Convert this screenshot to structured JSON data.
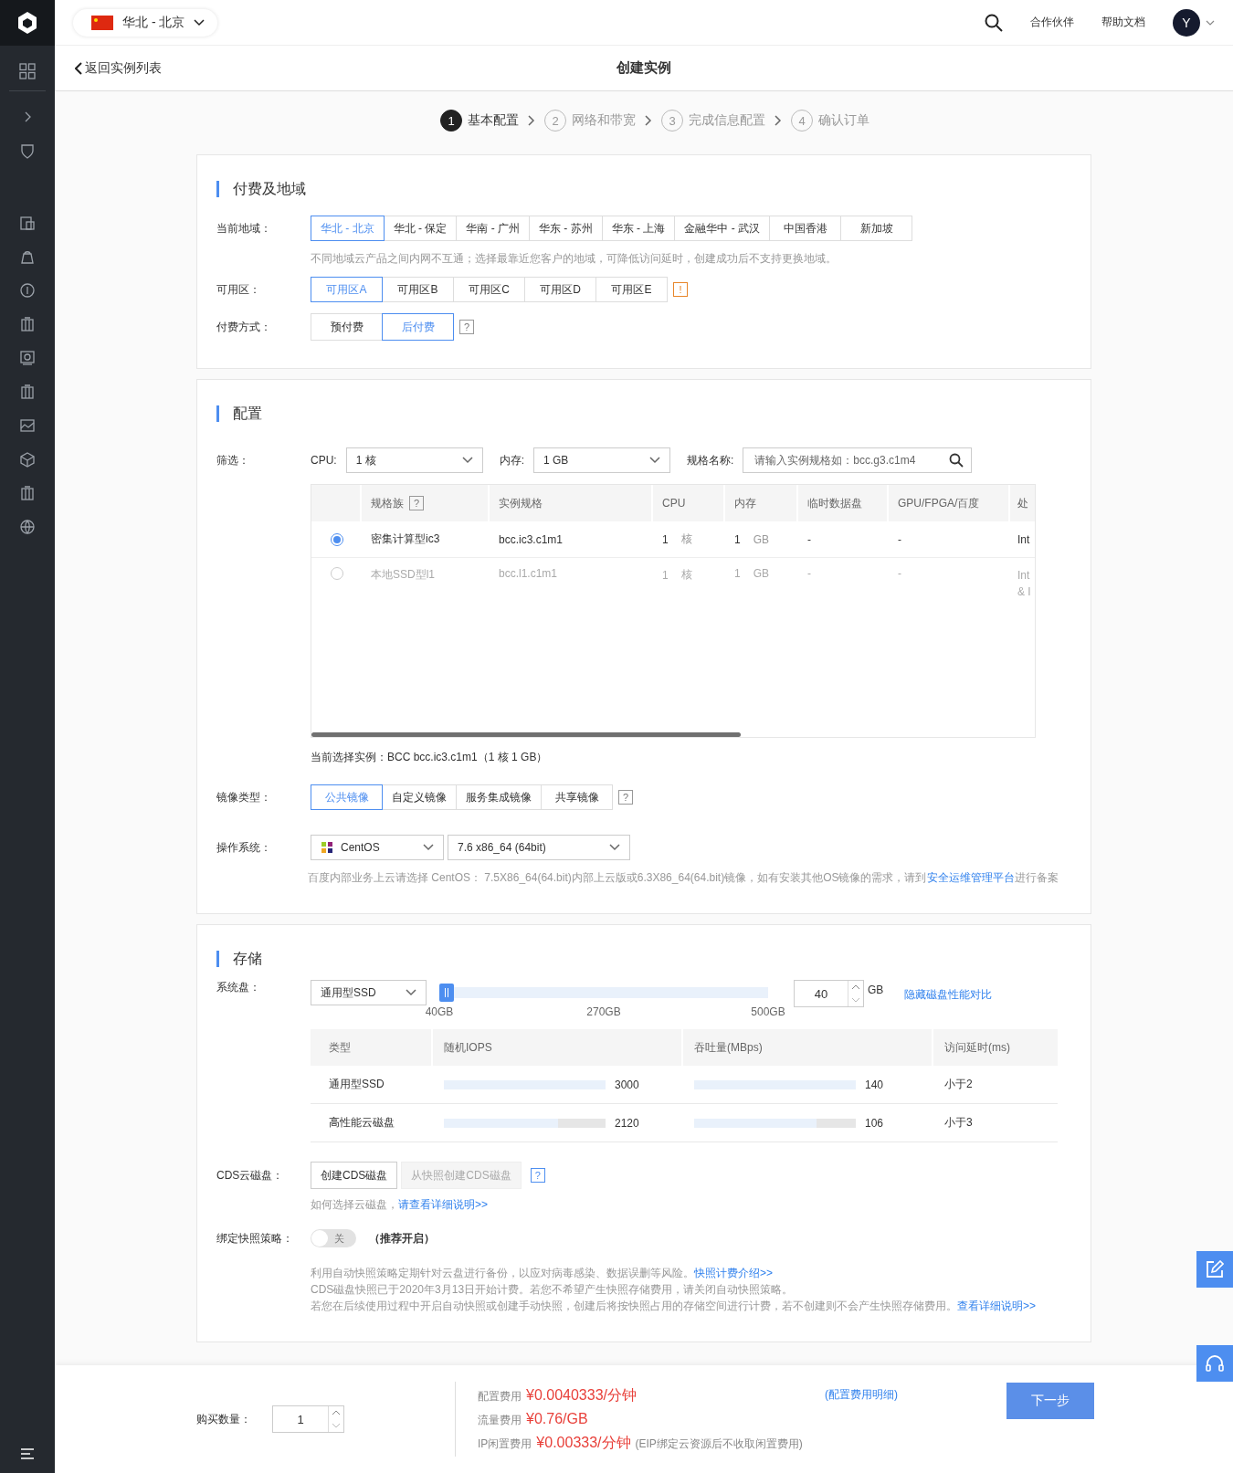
{
  "topbar": {
    "region": "华北 - 北京",
    "links": [
      "合作伙伴",
      "帮助文档"
    ],
    "avatar": "Y"
  },
  "header": {
    "back": "返回实例列表",
    "title": "创建实例"
  },
  "steps": [
    {
      "number": "1",
      "label": "基本配置",
      "selected": true
    },
    {
      "number": "2",
      "label": "网络和带宽",
      "selected": false
    },
    {
      "number": "3",
      "label": "完成信息配置",
      "selected": false
    },
    {
      "number": "4",
      "label": "确认订单",
      "selected": false
    }
  ],
  "billing": {
    "title": "付费及地域",
    "region_label": "当前地域：",
    "regions": [
      {
        "label": "华北 - 北京",
        "selected": true
      },
      {
        "label": "华北 - 保定",
        "selected": false
      },
      {
        "label": "华南 - 广州",
        "selected": false
      },
      {
        "label": "华东 - 苏州",
        "selected": false
      },
      {
        "label": "华东 - 上海",
        "selected": false
      },
      {
        "label": "金融华中 - 武汉",
        "selected": false
      },
      {
        "label": "中国香港",
        "selected": false
      },
      {
        "label": "新加坡",
        "selected": false
      }
    ],
    "region_hint": "不同地域云产品之间内网不互通；选择最靠近您客户的地域，可降低访问延时，创建成功后不支持更换地域。",
    "zone_label": "可用区：",
    "zones": [
      {
        "label": "可用区A",
        "selected": true
      },
      {
        "label": "可用区B",
        "selected": false
      },
      {
        "label": "可用区C",
        "selected": false
      },
      {
        "label": "可用区D",
        "selected": false
      },
      {
        "label": "可用区E",
        "selected": false
      }
    ],
    "zone_warning": "!",
    "payment_label": "付费方式：",
    "payments": [
      {
        "label": "预付费",
        "selected": false
      },
      {
        "label": "后付费",
        "selected": true
      }
    ],
    "payment_help": "?"
  },
  "config": {
    "title": "配置",
    "filter_label": "筛选：",
    "cpu_label": "CPU:",
    "cpu_value": "1 核",
    "memory_label": "内存:",
    "memory_value": "1 GB",
    "spec_label": "规格名称:",
    "spec_placeholder": "请输入实例规格如：bcc.g3.c1m4",
    "table": {
      "columns": [
        {
          "label": "规格族",
          "help": "?"
        },
        {
          "label": "实例规格"
        },
        {
          "label": "CPU"
        },
        {
          "label": "内存"
        },
        {
          "label": "临时数据盘"
        },
        {
          "label": "GPU/FPGA/百度"
        },
        {
          "label": "处"
        }
      ],
      "rows": [
        {
          "selected": true,
          "disabled": false,
          "family": "密集计算型ic3",
          "spec": "bcc.ic3.c1m1",
          "cpu": "1",
          "cpu_unit": "核",
          "memory": "1",
          "memory_unit": "GB",
          "disk": "-",
          "gpu": "-",
          "column_7": "Int"
        },
        {
          "selected": false,
          "disabled": true,
          "family": "本地SSD型l1",
          "spec": "bcc.l1.c1m1",
          "cpu": "1",
          "cpu_unit": "核",
          "memory": "1",
          "memory_unit": "GB",
          "disk": "-",
          "gpu": "-",
          "column_7": "Int & I"
        }
      ]
    },
    "current": "当前选择实例：BCC bcc.ic3.c1m1（1 核 1 GB）",
    "image_label": "镜像类型：",
    "images": [
      {
        "label": "公共镜像",
        "selected": true
      },
      {
        "label": "自定义镜像",
        "selected": false
      },
      {
        "label": "服务集成镜像",
        "selected": false
      },
      {
        "label": "共享镜像",
        "selected": false
      }
    ],
    "image_help": "?",
    "os_label": "操作系统：",
    "os": "CentOS",
    "os_version": "7.6 x86_64 (64bit)",
    "os_hint": "百度内部业务上云请选择 CentOS： 7.5X86_64(64.bit)内部上云版或6.3X86_64(64.bit)镜像，如有安装其他OS镜像的需求，请到",
    "os_hint_link": "安全运维管理平台",
    "os_hint_end": "进行备案"
  },
  "storage": {
    "title": "存储",
    "disk_label": "系统盘：",
    "disk_type": "通用型SSD",
    "level": 0,
    "ticks": [
      "40GB",
      "270GB",
      "500GB"
    ],
    "size": "40",
    "unit": "GB",
    "compare_link": "隐藏磁盘性能对比",
    "perf_columns": [
      "类型",
      "随机IOPS",
      "吞吐量(MBps)",
      "访问延时(ms)"
    ],
    "perf_rows": [
      {
        "type": "通用型SSD",
        "iops": {
          "level": 1,
          "reading": "3000"
        },
        "throughput": {
          "level": 1,
          "reading": "140"
        },
        "latency": "小于2"
      },
      {
        "type": "高性能云磁盘",
        "iops": {
          "level": 0.707,
          "reading": "2120"
        },
        "throughput": {
          "level": 0.757,
          "reading": "106"
        },
        "latency": "小于3"
      }
    ],
    "cds_label": "CDS云磁盘：",
    "cds_buttons": [
      {
        "label": "创建CDS磁盘",
        "disabled": false
      },
      {
        "label": "从快照创建CDS磁盘",
        "disabled": true
      }
    ],
    "cds_help": "?",
    "cds_hint": "如何选择云磁盘，",
    "cds_hint_link": "请查看详细说明>>",
    "snapshot_label": "绑定快照策略：",
    "snapshot_on": false,
    "snapshot_switch_text": "关",
    "snapshot_recommend": "（推荐开启）",
    "notes": [
      {
        "text": "利用自动快照策略定期针对云盘进行备份，以应对病毒感染、数据误删等风险。",
        "link": "快照计费介绍>>"
      },
      {
        "text": "CDS磁盘快照已于2020年3月13日开始计费。若您不希望产生快照存储费用，请关闭自动快照策略。"
      },
      {
        "text": "若您在后续使用过程中开启自动快照或创建手动快照，创建后将按快照占用的存储空间进行计费，若不创建则不会产生快照存储费用。",
        "link": "查看详细说明>>"
      }
    ]
  },
  "footer": {
    "quantity_label": "购买数量：",
    "quantity": "1",
    "fees": [
      {
        "label": "配置费用",
        "amount": "¥0.0040333/分钟"
      },
      {
        "label": "流量费用",
        "amount": "¥0.76/GB"
      },
      {
        "label": "IP闲置费用",
        "amount": "¥0.00333/分钟",
        "note": "(EIP绑定云资源后不收取闲置费用)"
      }
    ],
    "detail_link": "(配置费用明细)",
    "next": "下一步"
  }
}
